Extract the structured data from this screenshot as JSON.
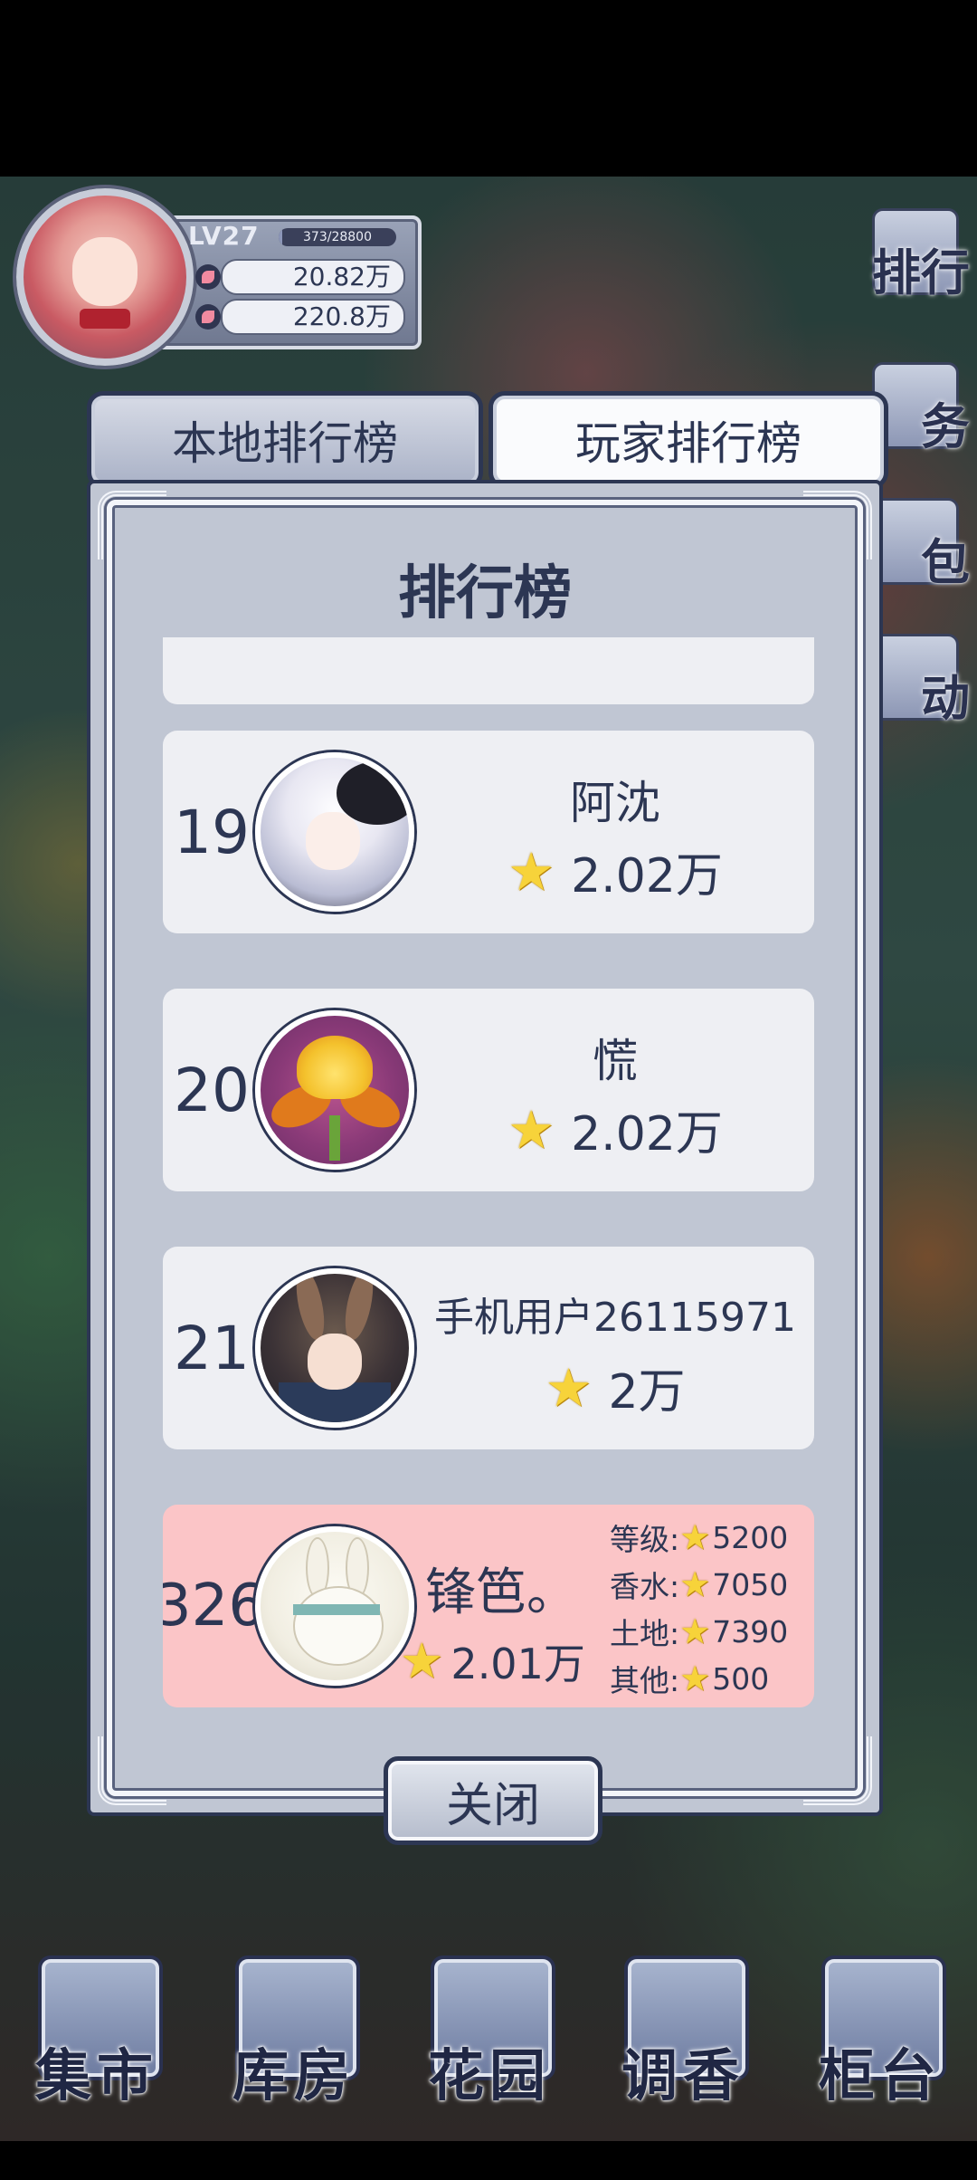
{
  "player": {
    "level": "LV27",
    "exp_text": "373/28800",
    "exp_progress": 0.013,
    "resource_1": "20.82万",
    "resource_2": "220.8万"
  },
  "side_menu": {
    "items": [
      {
        "label": "排行",
        "icon": "ranking-icon"
      },
      {
        "label": "务",
        "icon": "task-icon"
      },
      {
        "label": "包",
        "icon": "bag-icon"
      },
      {
        "label": "动",
        "icon": "event-icon"
      }
    ]
  },
  "tabs": {
    "local": "本地排行榜",
    "player": "玩家排行榜",
    "active": "player"
  },
  "panel": {
    "title": "排行榜",
    "close_label": "关闭"
  },
  "rankings": [
    {
      "rank": "19",
      "name": "阿沈",
      "score": "2.02万"
    },
    {
      "rank": "20",
      "name": "慌",
      "score": "2.02万"
    },
    {
      "rank": "21",
      "name": "手机用户26115971",
      "score": "2万"
    }
  ],
  "me": {
    "rank": "326",
    "name": "锋笆。",
    "score": "2.01万",
    "details": [
      {
        "label": "等级:",
        "value": "5200"
      },
      {
        "label": "香水:",
        "value": "7050"
      },
      {
        "label": "土地:",
        "value": "7390"
      },
      {
        "label": "其他:",
        "value": "500"
      }
    ]
  },
  "bottom_nav": {
    "items": [
      {
        "label": "集市"
      },
      {
        "label": "库房"
      },
      {
        "label": "花园"
      },
      {
        "label": "调香"
      },
      {
        "label": "柜台"
      }
    ]
  },
  "colors": {
    "accent": "#2c3653",
    "panel_bg": "#c0c6d3",
    "row_bg": "#eeeff3",
    "my_row_bg": "#fbc5c7",
    "star": "#f7d33a"
  }
}
